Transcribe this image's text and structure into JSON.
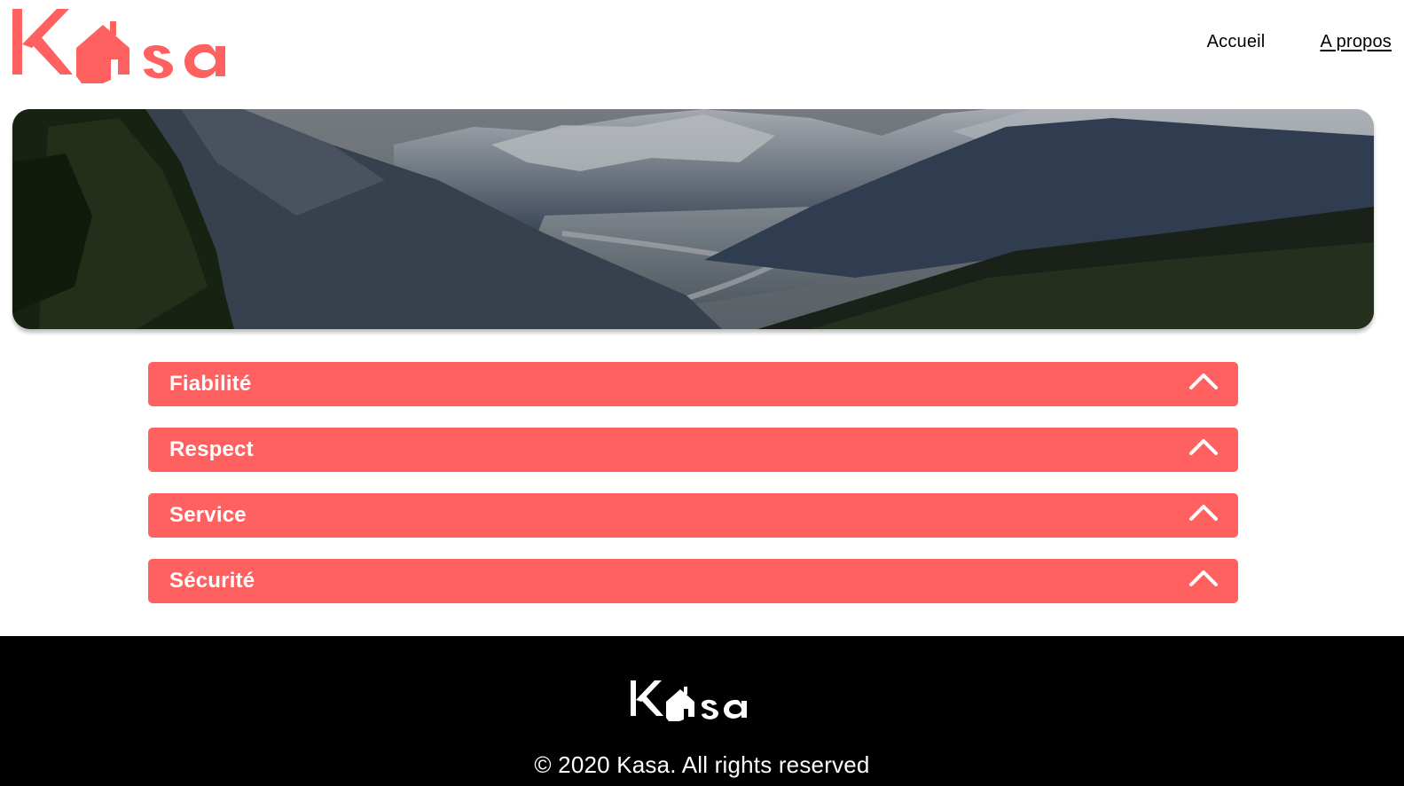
{
  "brand": {
    "name": "Kasa",
    "accent_color": "#ff6060"
  },
  "nav": {
    "items": [
      {
        "label": "Accueil"
      },
      {
        "label": "A propos"
      }
    ]
  },
  "banner": {
    "icon": "mountain-landscape-image"
  },
  "collapses": [
    {
      "title": "Fiabilité",
      "icon": "chevron-up-icon"
    },
    {
      "title": "Respect",
      "icon": "chevron-up-icon"
    },
    {
      "title": "Service",
      "icon": "chevron-up-icon"
    },
    {
      "title": "Sécurité",
      "icon": "chevron-up-icon"
    }
  ],
  "footer": {
    "copyright": "© 2020 Kasa. All rights reserved"
  }
}
